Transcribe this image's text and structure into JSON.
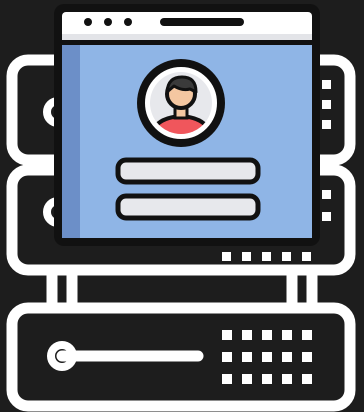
{
  "illustration": {
    "subject": "user-profile-window-over-server-rack",
    "colors": {
      "background": "#1d1d1d",
      "server_line": "#ffffff",
      "window_frame": "#111111",
      "window_title_bar": "#ffffff",
      "window_body": "#8fb5e6",
      "window_body_shadow": "#6c8fc8",
      "avatar_ring": "#ffffff",
      "avatar_bg": "#8fb5e6",
      "avatar_skin": "#f4c7a1",
      "avatar_hair": "#3a3a3a",
      "avatar_shirt": "#f0565c",
      "form_field": "#e7e8ec"
    },
    "icons": [
      "server-rack-icon",
      "browser-window-icon",
      "user-avatar-icon",
      "text-field-icon"
    ]
  }
}
